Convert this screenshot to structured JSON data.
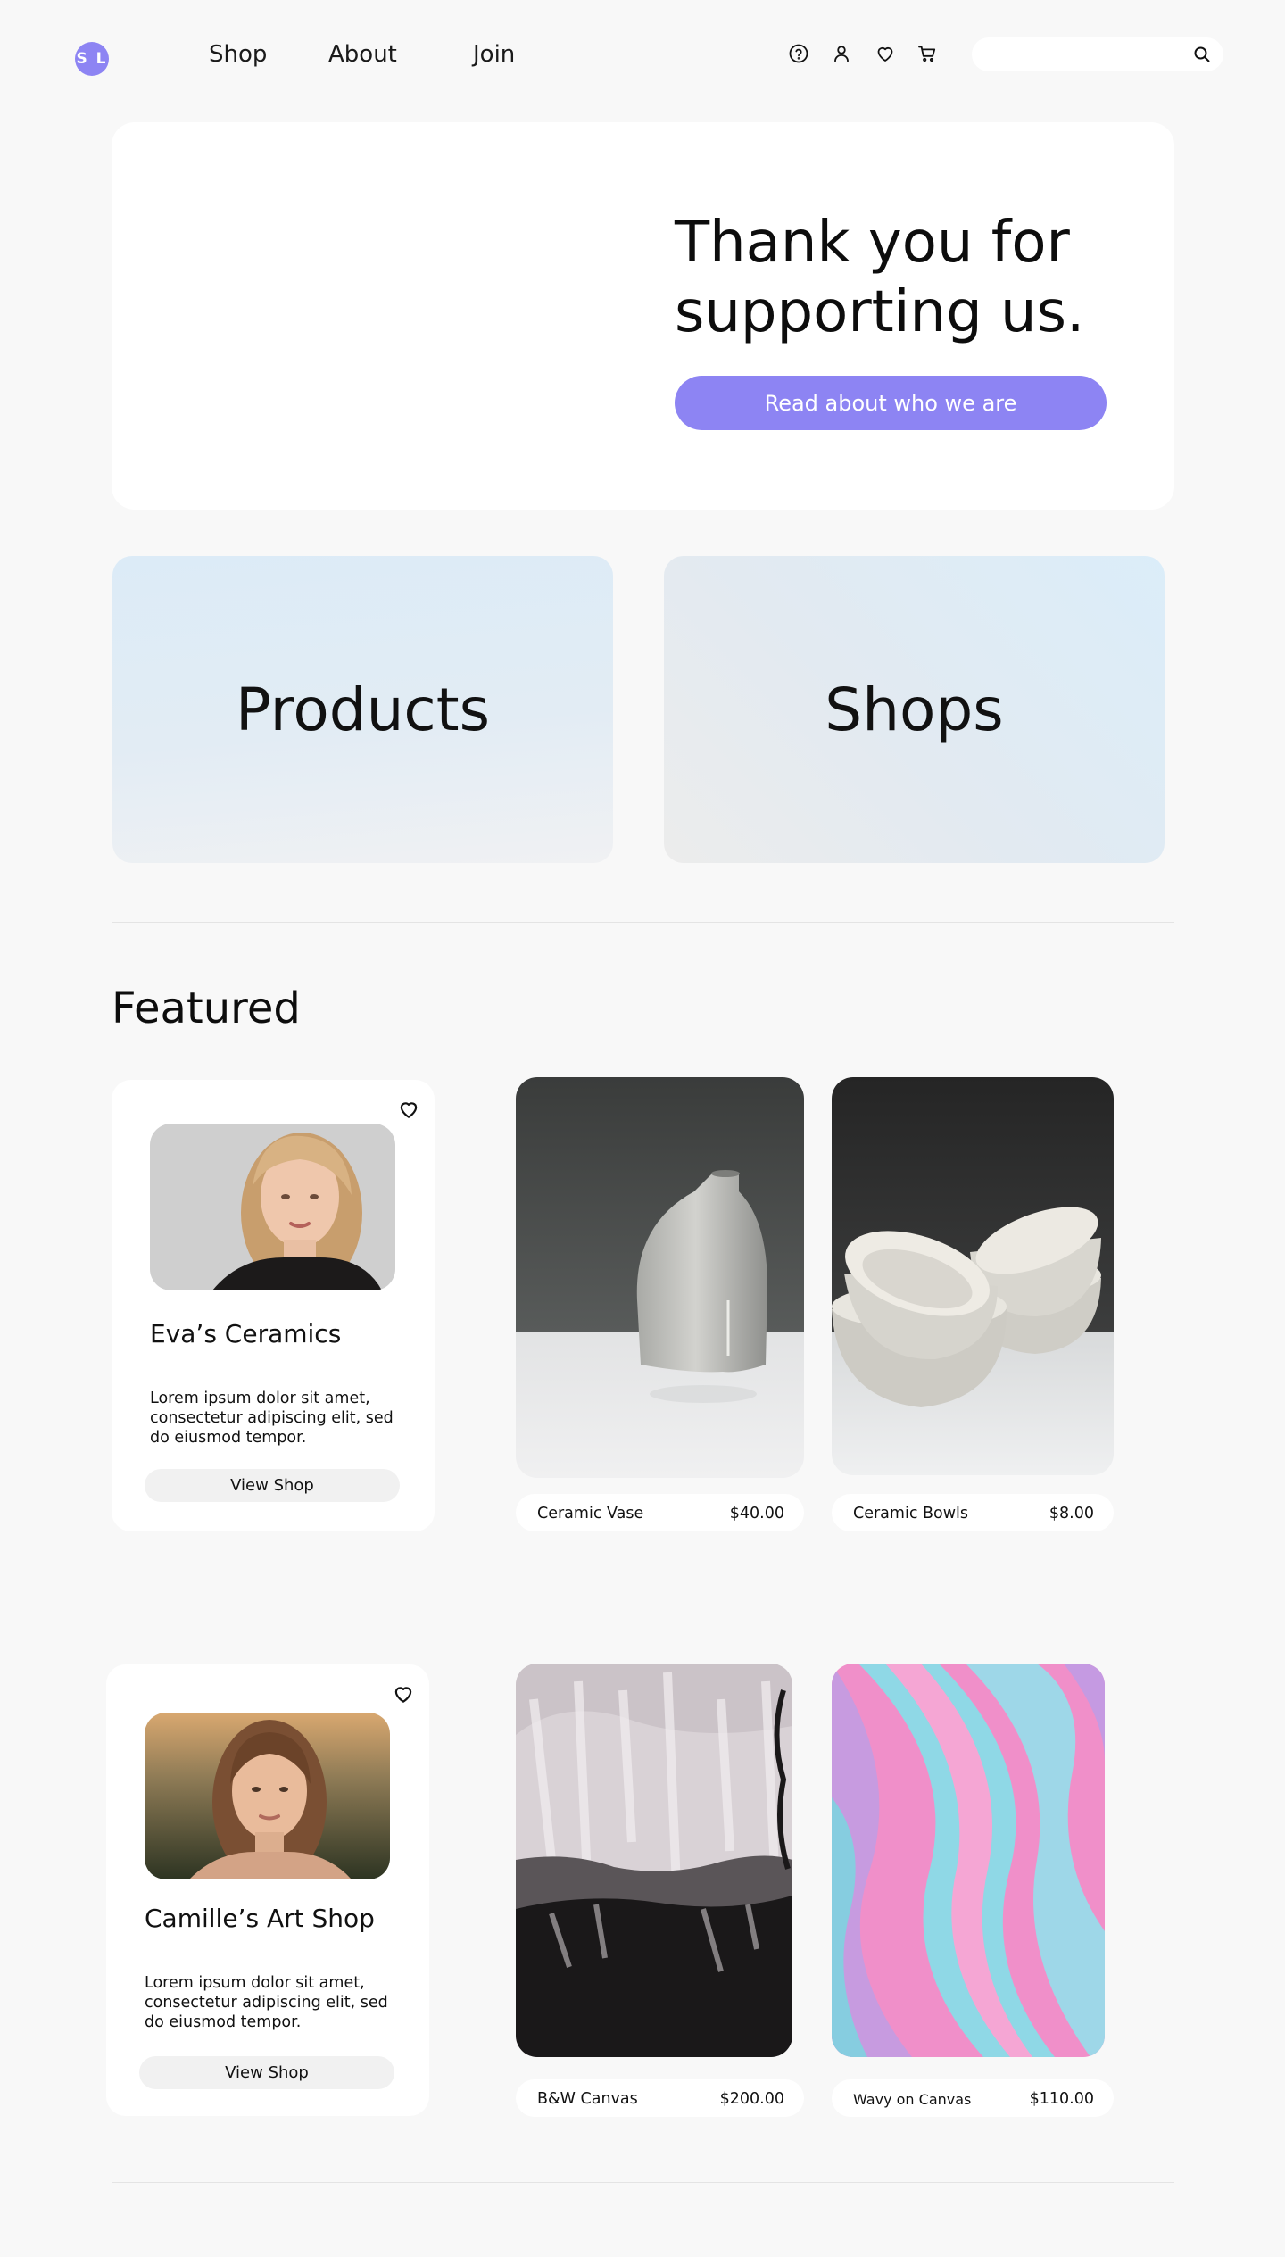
{
  "header": {
    "logo_text": "S L",
    "nav": {
      "shop": "Shop",
      "about": "About",
      "join": "Join"
    },
    "icons": [
      "help-icon",
      "user-icon",
      "heart-icon",
      "cart-icon"
    ],
    "search": {
      "value": "",
      "placeholder": "",
      "icon": "search-icon"
    }
  },
  "hero": {
    "headline": "Thank you for supporting us.",
    "cta_label": "Read about who we are"
  },
  "categories": {
    "products": "Products",
    "shops": "Shops"
  },
  "featured": {
    "title": "Featured",
    "shops": [
      {
        "name": "Eva’s Ceramics",
        "description": "Lorem ipsum dolor sit amet, consectetur adipiscing elit, sed do eiusmod tempor.",
        "button": "View Shop",
        "products": [
          {
            "name": "Ceramic Vase",
            "price": "$40.00"
          },
          {
            "name": "Ceramic Bowls",
            "price": "$8.00"
          }
        ]
      },
      {
        "name": "Camille’s Art Shop",
        "description": "Lorem ipsum dolor sit amet, consectetur adipiscing elit, sed do eiusmod tempor.",
        "button": "View Shop",
        "products": [
          {
            "name": "B&W Canvas",
            "price": "$200.00"
          },
          {
            "name": "Wavy on Canvas",
            "price": "$110.00"
          }
        ]
      }
    ]
  },
  "colors": {
    "accent": "#8d84f3",
    "background": "#f8f8f8",
    "card": "#ffffff"
  }
}
